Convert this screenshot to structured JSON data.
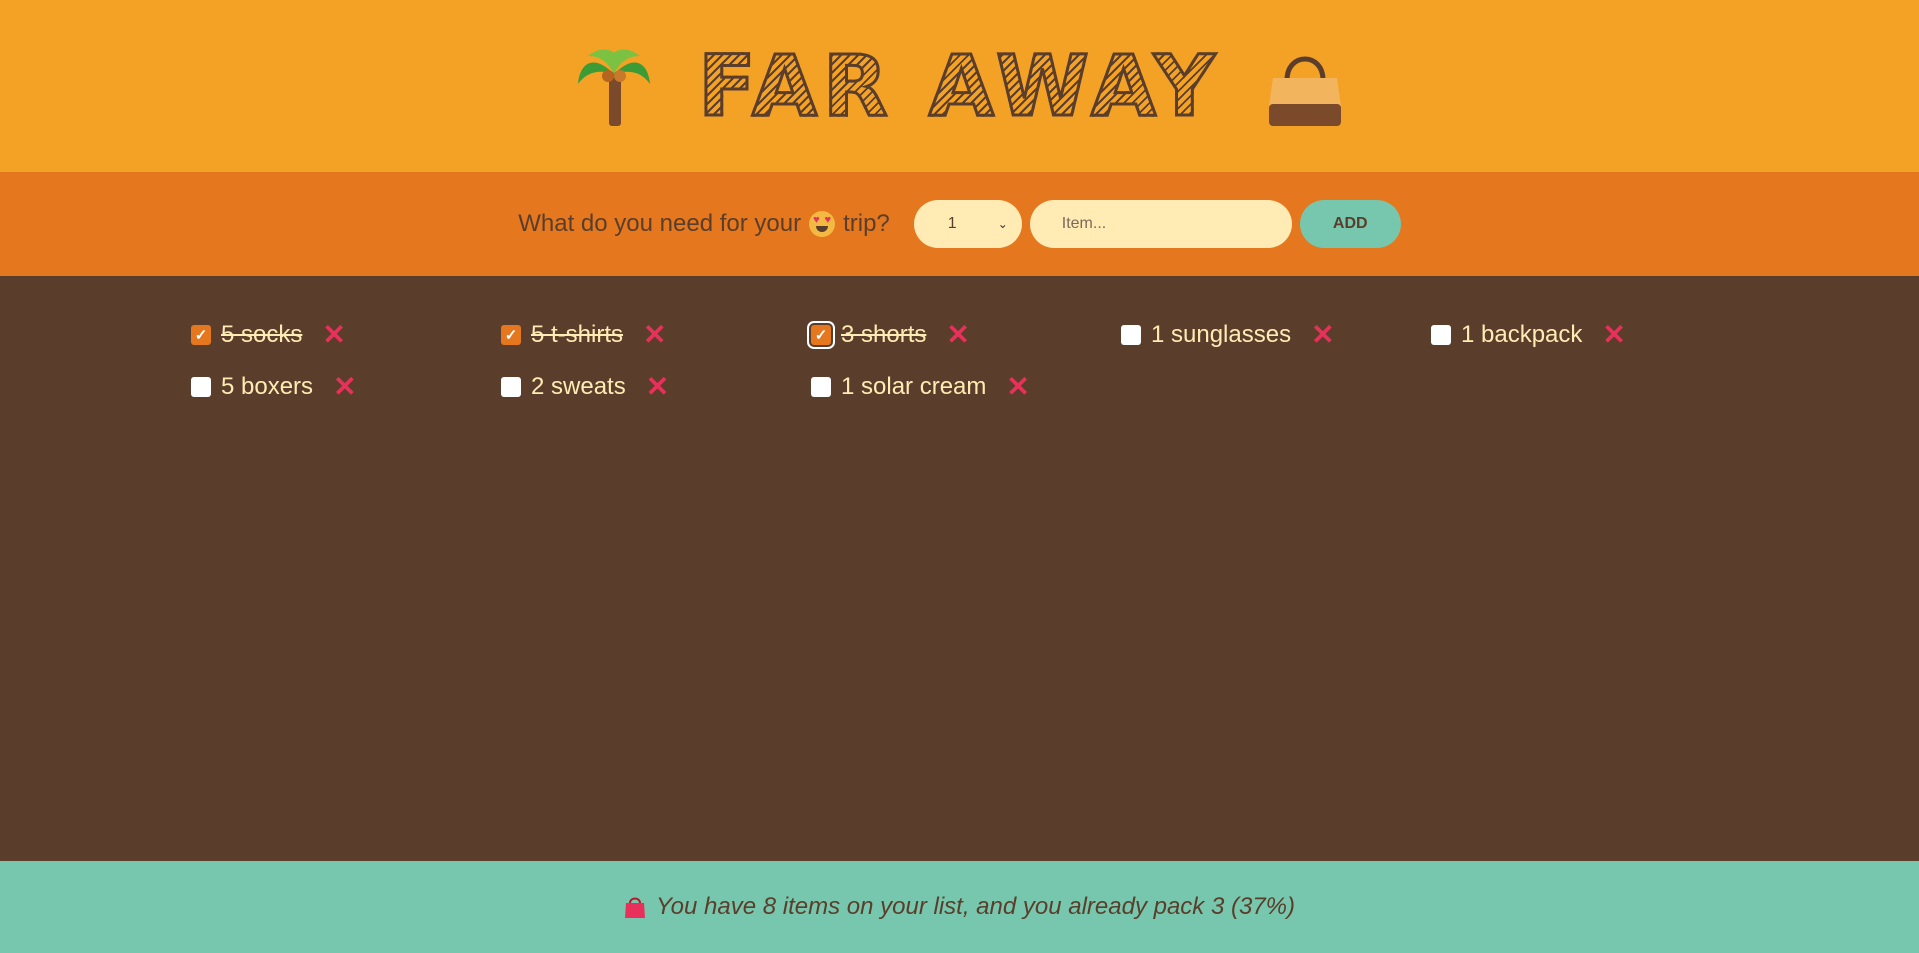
{
  "header": {
    "title": "FAR AWAY",
    "left_icon": "palm-tree-icon",
    "right_icon": "handbag-icon"
  },
  "form": {
    "question_prefix": "What do you need for your",
    "question_suffix": "trip?",
    "emoji": "heart-eyes-face-icon",
    "quantity_value": "1",
    "item_placeholder": "Item...",
    "add_label": "ADD"
  },
  "items": [
    {
      "label": "5 socks",
      "packed": true
    },
    {
      "label": "5 t-shirts",
      "packed": true
    },
    {
      "label": "3 shorts",
      "packed": true
    },
    {
      "label": "1 sunglasses",
      "packed": false
    },
    {
      "label": "1 backpack",
      "packed": false
    },
    {
      "label": "5 boxers",
      "packed": false
    },
    {
      "label": "2 sweats",
      "packed": false
    },
    {
      "label": "1 solar cream",
      "packed": false
    }
  ],
  "delete_glyph": "✕",
  "stats": {
    "icon": "shopping-bag-icon",
    "text": "You have 8 items on your list, and you already pack 3 (37%)"
  },
  "colors": {
    "header": "#f4a226",
    "form_bar": "#e5771e",
    "list_bg": "#5a3e2b",
    "stats_bg": "#76c7ad",
    "delete": "#e8305a",
    "text_light": "#ffebb3"
  }
}
